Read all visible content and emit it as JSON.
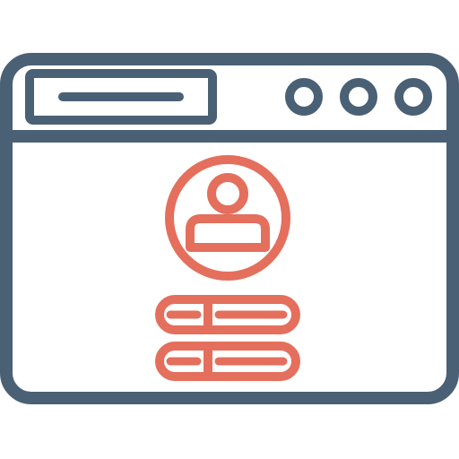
{
  "illustration": {
    "icon": "browser-window-user-profile-login-icon",
    "colors": {
      "outline": "#4a6075",
      "accent": "#e46f5c",
      "background": "#ffffff"
    },
    "window_control_count": 3,
    "form_field_count": 2
  }
}
